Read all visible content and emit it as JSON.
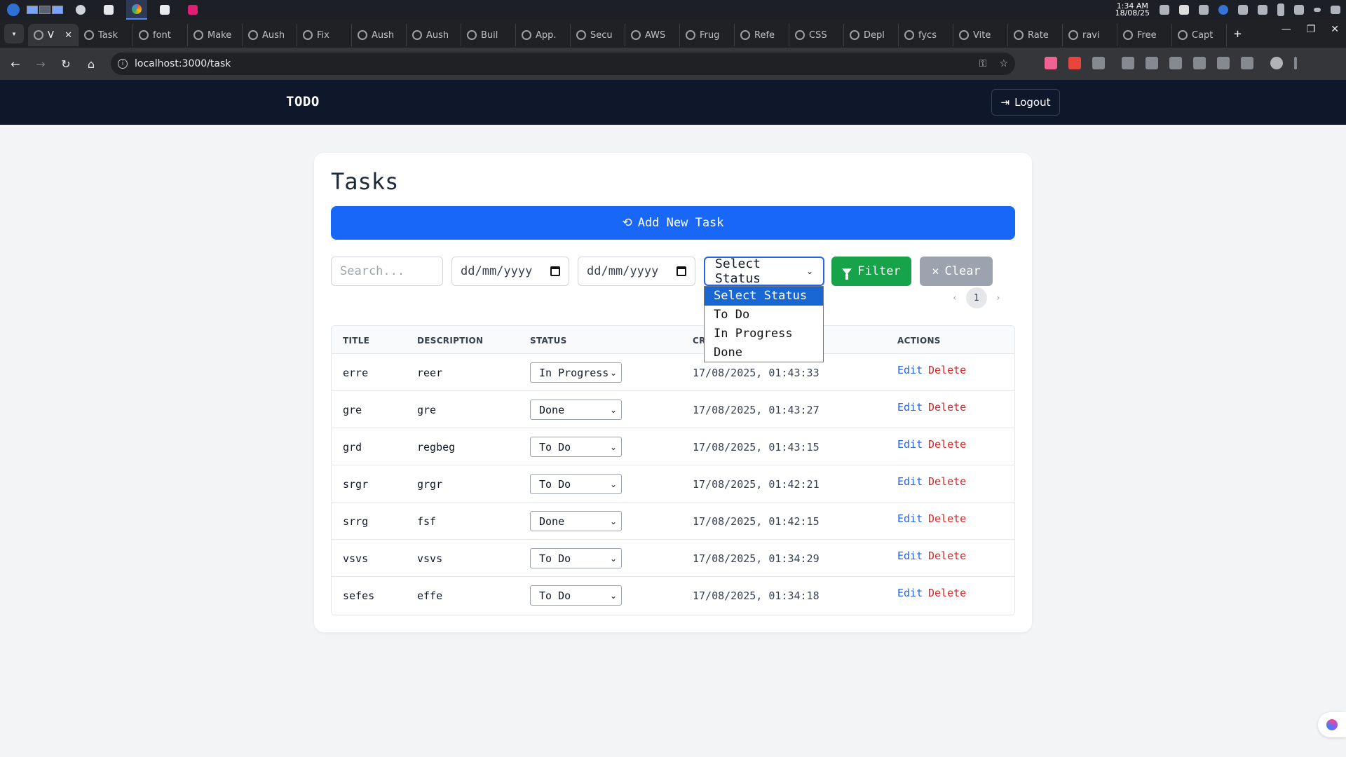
{
  "os": {
    "time": "1:34 AM",
    "date": "18/08/25"
  },
  "browser": {
    "tabs": [
      {
        "label": "V",
        "active": true
      },
      {
        "label": "Task"
      },
      {
        "label": "font"
      },
      {
        "label": "Make"
      },
      {
        "label": "Aush"
      },
      {
        "label": "Fix"
      },
      {
        "label": "Aush"
      },
      {
        "label": "Aush"
      },
      {
        "label": "Buil"
      },
      {
        "label": "App."
      },
      {
        "label": "Secu"
      },
      {
        "label": "AWS"
      },
      {
        "label": "Frug"
      },
      {
        "label": "Refe"
      },
      {
        "label": "CSS"
      },
      {
        "label": "Depl"
      },
      {
        "label": "fycs"
      },
      {
        "label": "Vite"
      },
      {
        "label": "Rate"
      },
      {
        "label": "ravi"
      },
      {
        "label": "Free"
      },
      {
        "label": "Capt"
      }
    ],
    "url": "localhost:3000/task"
  },
  "navbar": {
    "brand": "TODO",
    "logout_label": "Logout"
  },
  "page": {
    "title": "Tasks",
    "add_button": "Add New Task"
  },
  "filters": {
    "search_placeholder": "Search...",
    "date_from": "dd/mm/yyyy",
    "date_to": "dd/mm/yyyy",
    "status_value": "Select Status",
    "status_options": [
      "Select Status",
      "To Do",
      "In Progress",
      "Done"
    ],
    "filter_label": "Filter",
    "clear_label": "Clear"
  },
  "pagination": {
    "prev": "‹",
    "current": "1",
    "next": "›"
  },
  "table": {
    "headers": {
      "title": "TITLE",
      "description": "DESCRIPTION",
      "status": "STATUS",
      "created": "CR",
      "actions": "ACTIONS"
    },
    "edit_label": "Edit",
    "delete_label": "Delete",
    "rows": [
      {
        "title": "erre",
        "description": "reer",
        "status": "In Progress",
        "created": "17/08/2025, 01:43:33"
      },
      {
        "title": "gre",
        "description": "gre",
        "status": "Done",
        "created": "17/08/2025, 01:43:27"
      },
      {
        "title": "grd",
        "description": "regbeg",
        "status": "To Do",
        "created": "17/08/2025, 01:43:15"
      },
      {
        "title": "srgr",
        "description": "grgr",
        "status": "To Do",
        "created": "17/08/2025, 01:42:21"
      },
      {
        "title": "srrg",
        "description": "fsf",
        "status": "Done",
        "created": "17/08/2025, 01:42:15"
      },
      {
        "title": "vsvs",
        "description": "vsvs",
        "status": "To Do",
        "created": "17/08/2025, 01:34:29"
      },
      {
        "title": "sefes",
        "description": "effe",
        "status": "To Do",
        "created": "17/08/2025, 01:34:18"
      }
    ]
  },
  "colors": {
    "primary": "#1967f6",
    "success": "#16a34a",
    "muted": "#9ca3af",
    "danger": "#dc2626",
    "navbar": "#0f172a"
  }
}
